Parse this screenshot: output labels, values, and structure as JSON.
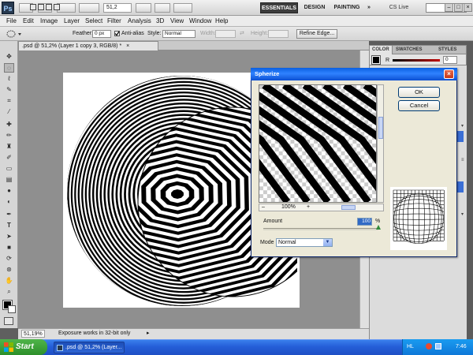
{
  "app": {
    "logo": "Ps",
    "zoom": "51,2",
    "workspaces": [
      "ESSENTIALS",
      "DESIGN",
      "PAINTING"
    ],
    "overflow": "»",
    "cs_live": "CS Live",
    "window_controls": [
      "–",
      "□",
      "×"
    ]
  },
  "menu": [
    "File",
    "Edit",
    "Image",
    "Layer",
    "Select",
    "Filter",
    "Analysis",
    "3D",
    "View",
    "Window",
    "Help"
  ],
  "options_bar": {
    "feather_label": "Feather:",
    "feather_value": "0 px",
    "antialias_label": "Anti-alias",
    "style_label": "Style:",
    "style_value": "Normal",
    "width_label": "Width:",
    "height_label": "Height:",
    "refine_edge": "Refine Edge..."
  },
  "document": {
    "tab_title": ".psd @ 51,2% (Layer 1 copy 3, RGB/8) *",
    "tab_close": "×"
  },
  "status": {
    "zoom": "51,19%",
    "message": "Exposure works in 32-bit only"
  },
  "panels": {
    "tabs": [
      "COLOR",
      "SWATCHES",
      "STYLES"
    ],
    "channel_label": "R",
    "channel_value": "0"
  },
  "dialog": {
    "title": "Spherize",
    "close": "×",
    "ok": "OK",
    "cancel": "Cancel",
    "zoom_minus": "–",
    "zoom": "100%",
    "zoom_plus": "+",
    "amount_label": "Amount",
    "amount_value": "100",
    "amount_unit": "%",
    "mode_label": "Mode",
    "mode_value": "Normal"
  },
  "taskbar": {
    "start": "Start",
    "task_button": ".psd @ 51,2% (Layer...",
    "lang": "HL",
    "time": "7:46"
  },
  "colors": {
    "title_blue": "#2f82ff",
    "taskbar_blue": "#245ed8",
    "start_green": "#2d8f2a",
    "accent_red": "#cc2222"
  }
}
